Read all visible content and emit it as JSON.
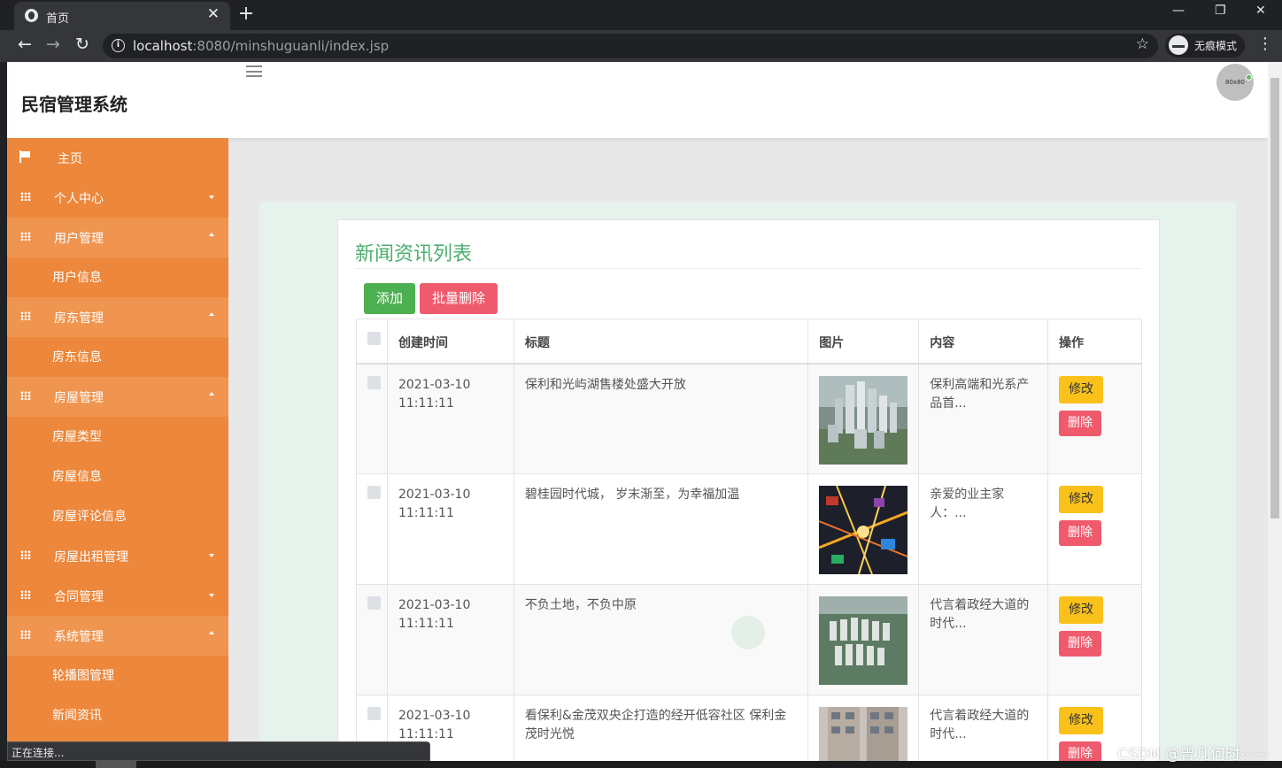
{
  "browser": {
    "tab_title": "首页",
    "tab_close": "✕",
    "new_tab": "+",
    "url_host": "localhost",
    "url_rest": ":8080/minshuguanli/index.jsp",
    "incognito_label": "无痕模式",
    "window_controls": {
      "minimize": "—",
      "restore": "❐",
      "close": "✕"
    },
    "status_text": "正在连接..."
  },
  "header": {
    "app_title": "民宿管理系统",
    "avatar_text": "80x80"
  },
  "sidebar": {
    "items": [
      {
        "label": "主页",
        "icon": "flag-icon"
      },
      {
        "label": "个人中心",
        "icon": "grid-icon",
        "state": "collapsed"
      },
      {
        "label": "用户管理",
        "icon": "grid-icon",
        "state": "open"
      },
      {
        "label": "用户信息",
        "sub": true
      },
      {
        "label": "房东管理",
        "icon": "grid-icon",
        "state": "open"
      },
      {
        "label": "房东信息",
        "sub": true
      },
      {
        "label": "房屋管理",
        "icon": "grid-icon",
        "state": "open"
      },
      {
        "label": "房屋类型",
        "sub": true
      },
      {
        "label": "房屋信息",
        "sub": true
      },
      {
        "label": "房屋评论信息",
        "sub": true
      },
      {
        "label": "房屋出租管理",
        "icon": "grid-icon",
        "state": "collapsed"
      },
      {
        "label": "合同管理",
        "icon": "grid-icon",
        "state": "collapsed"
      },
      {
        "label": "系统管理",
        "icon": "grid-icon",
        "state": "open"
      },
      {
        "label": "轮播图管理",
        "sub": true
      },
      {
        "label": "新闻资讯",
        "sub": true
      }
    ]
  },
  "main": {
    "panel_title": "新闻资讯列表",
    "add_label": "添加",
    "batch_delete_label": "批量删除",
    "columns": [
      "创建时间",
      "标题",
      "图片",
      "内容",
      "操作"
    ],
    "edit_label": "修改",
    "delete_label": "删除",
    "rows": [
      {
        "date": "2021-03-10",
        "time": "11:11:11",
        "title": "保利和光屿湖售楼处盛大开放",
        "content": "保利高端和光系产品首...",
        "image": "aerial-city-towers"
      },
      {
        "date": "2021-03-10",
        "time": "11:11:11",
        "title": "碧桂园时代城， 岁末渐至，为幸福加温",
        "content": "亲爱的业主家人：...",
        "image": "night-traffic-map"
      },
      {
        "date": "2021-03-10",
        "time": "11:11:11",
        "title": "不负土地，不负中原",
        "content": "代言着政经大道的时代...",
        "image": "aerial-residential-blocks"
      },
      {
        "date": "2021-03-10",
        "time": "11:11:11",
        "title": "看保利&金茂双央企打造的经开低容社区 保利金茂时光悦",
        "content": "代言着政经大道的时代...",
        "image": "apartment-facade"
      }
    ]
  },
  "watermark": "CSDN @曾几何时⋯⋯",
  "colors": {
    "sidebar": "#ed873b",
    "sidebar_open": "#ef9550",
    "title_green": "#4caf6e",
    "add": "#4caf50",
    "delete": "#ef5b6d",
    "edit": "#f9c11a"
  }
}
